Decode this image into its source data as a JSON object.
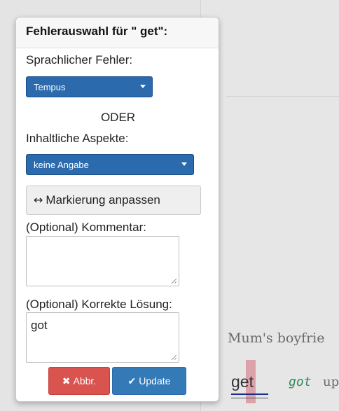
{
  "popover": {
    "title": "Fehlerauswahl für \" get\":",
    "linguistic_error_label": "Sprachlicher Fehler:",
    "linguistic_error_selected": "Tempus",
    "or_label": "ODER",
    "content_aspects_label": "Inhaltliche Aspekte:",
    "content_aspects_selected": "keine Angabe",
    "adjust_marking_label": "Markierung anpassen",
    "comment_label": "(Optional) Kommentar:",
    "comment_value": "",
    "correct_solution_label": "(Optional) Korrekte Lösung:",
    "correct_solution_value": "got",
    "cancel_label": "Abbr.",
    "update_label": "Update"
  },
  "document": {
    "sentence_fragment": "Mum's boyfrie",
    "marked_word": "get",
    "correction": "got",
    "following_text": "up"
  },
  "icons": {
    "adjust": "left-right-arrow-icon",
    "cancel": "times-icon",
    "update": "check-icon"
  },
  "colors": {
    "select_blue": "#2a6aad",
    "cancel_red": "#d9534f",
    "update_blue": "#337ab7",
    "correction_green": "#2e8b57",
    "mark_pink": "#d98a96"
  }
}
